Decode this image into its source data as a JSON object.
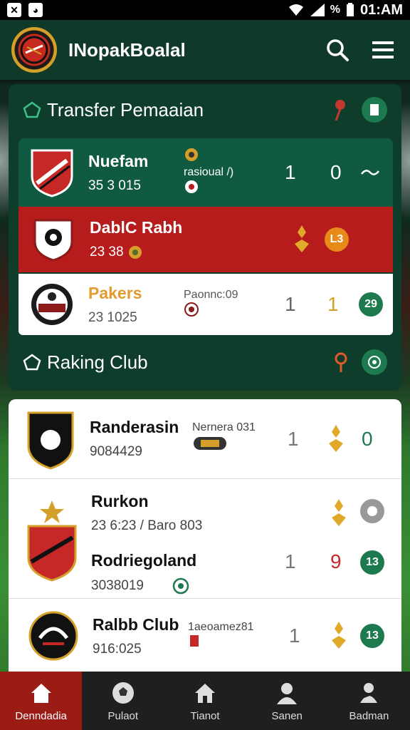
{
  "status": {
    "time": "01:AM",
    "signal": "%"
  },
  "appbar": {
    "title": "INopakBoalal"
  },
  "section1": {
    "title": "Transfer Pemaaian",
    "rows": [
      {
        "name": "Nuefam",
        "sub": "35 3 015",
        "mid": "rasioual /)",
        "score1": "1",
        "score2": "0"
      },
      {
        "name": "DablC Rabh",
        "sub": "23 38",
        "badge": "L3"
      },
      {
        "name": "Pakers",
        "sub": "23 1025",
        "mid": "Paonnc:09",
        "score1": "1",
        "score2": "1",
        "badge": "29"
      }
    ]
  },
  "section2": {
    "title": "Raking Club"
  },
  "list": [
    {
      "name": "Randerasin",
      "sub": "9084429",
      "mid": "Nernera 031",
      "score1": "1",
      "score2": "0"
    },
    {
      "name": "Rurkon",
      "sub": "23 6:23 / Baro 803"
    },
    {
      "name": "Rodriegoland",
      "sub": "3038019",
      "score1": "1",
      "score2": "9",
      "badge": "13"
    },
    {
      "name": "Ralbb Club",
      "sub": "916:025",
      "mid": "1aeoamez81",
      "score1": "1",
      "badge": "13"
    }
  ],
  "nav": [
    {
      "label": "Denndadia"
    },
    {
      "label": "Pulaot"
    },
    {
      "label": "Tianot"
    },
    {
      "label": "Sanen"
    },
    {
      "label": "Badman"
    }
  ],
  "colors": {
    "green": "#0f5a41",
    "red": "#b71c1c",
    "accentGreen": "#1d7a4e",
    "orange": "#e88a1a"
  }
}
